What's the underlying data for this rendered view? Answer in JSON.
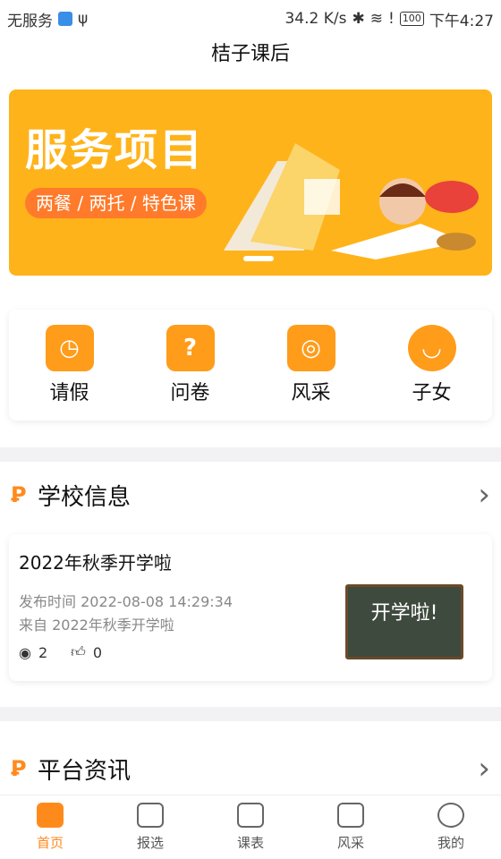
{
  "status_bar": {
    "carrier": "无服务",
    "speed": "34.2 K/s",
    "battery": "100",
    "time": "下午4:27"
  },
  "header": {
    "title": "桔子课后"
  },
  "banner": {
    "heading": "服务项目",
    "tagline": "两餐 / 两托 / 特色课",
    "background": "#ffb31a"
  },
  "quick_actions": [
    {
      "label": "请假",
      "icon": "leave-icon"
    },
    {
      "label": "问卷",
      "icon": "survey-icon"
    },
    {
      "label": "风采",
      "icon": "camera-icon"
    },
    {
      "label": "子女",
      "icon": "child-face-icon"
    }
  ],
  "school_info": {
    "heading": "学校信息",
    "card": {
      "title": "2022年秋季开学啦",
      "published": "发布时间 2022-08-08 14:29:34",
      "source": "来自 2022年秋季开学啦",
      "views": "2",
      "likes": "0",
      "thumb_text": "开学啦!"
    }
  },
  "platform_news": {
    "heading": "平台资讯"
  },
  "tabbar": {
    "items": [
      {
        "label": "首页"
      },
      {
        "label": "报选"
      },
      {
        "label": "课表"
      },
      {
        "label": "风采"
      },
      {
        "label": "我的"
      }
    ],
    "active_color": "#ff8a1c"
  }
}
